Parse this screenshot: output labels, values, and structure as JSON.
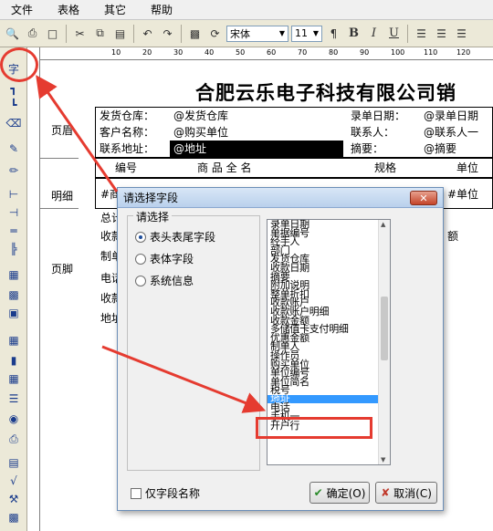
{
  "menu": [
    "文件",
    "表格",
    "其它",
    "帮助"
  ],
  "toolbar": {
    "font_name": "宋体",
    "font_size": "11",
    "bold": "B",
    "italic": "I",
    "underline": "U"
  },
  "ruler_marks": [
    "10",
    "20",
    "30",
    "40",
    "50",
    "60",
    "70",
    "80",
    "90",
    "100",
    "110",
    "120"
  ],
  "bands": {
    "header": "页眉",
    "detail": "明细",
    "footer": "页脚"
  },
  "report": {
    "title": "合肥云乐电子科技有限公司销",
    "header_fields": [
      {
        "label": "发货仓库：",
        "value": "@发货仓库"
      },
      {
        "label": "客户名称：",
        "value": "@购买单位"
      },
      {
        "label": "联系地址：",
        "value": "@地址"
      }
    ],
    "header_fields_right": [
      {
        "label": "录单日期：",
        "value": "@录单日期"
      },
      {
        "label": "联系人：",
        "value": "@联系人一"
      },
      {
        "label": "摘要：",
        "value": "@摘要"
      }
    ],
    "columns": [
      "编号",
      "商 品 全 名",
      "规格",
      "单位"
    ],
    "detail_left": "#商",
    "detail_right": "#单位",
    "footer_rows": [
      "总计",
      "收款",
      "制单",
      "电话",
      "收款",
      "地址"
    ],
    "footer_right": "额"
  },
  "dialog": {
    "title": "请选择字段",
    "close": "✕",
    "group_label": "请选择",
    "options": [
      "表头表尾字段",
      "表体字段",
      "系统信息"
    ],
    "selected_option": 0,
    "fields": [
      "录单日期",
      "单据编号",
      "经手人",
      "部门",
      "发货仓库",
      "收款日期",
      "摘要",
      "附加说明",
      "整单折扣",
      "收款账户",
      "收款账户明细",
      "收款金额",
      "多储值卡支付明细",
      "优惠金额",
      "制单人",
      "操作员",
      "购买单位",
      "单位编号",
      "单位简名",
      "税号",
      "地址",
      "电话",
      "手机一",
      "开户行"
    ],
    "selected_field": "地址",
    "checkbox_label": "仅字段名称",
    "ok_label": "确定(O)",
    "cancel_label": "取消(C)"
  }
}
